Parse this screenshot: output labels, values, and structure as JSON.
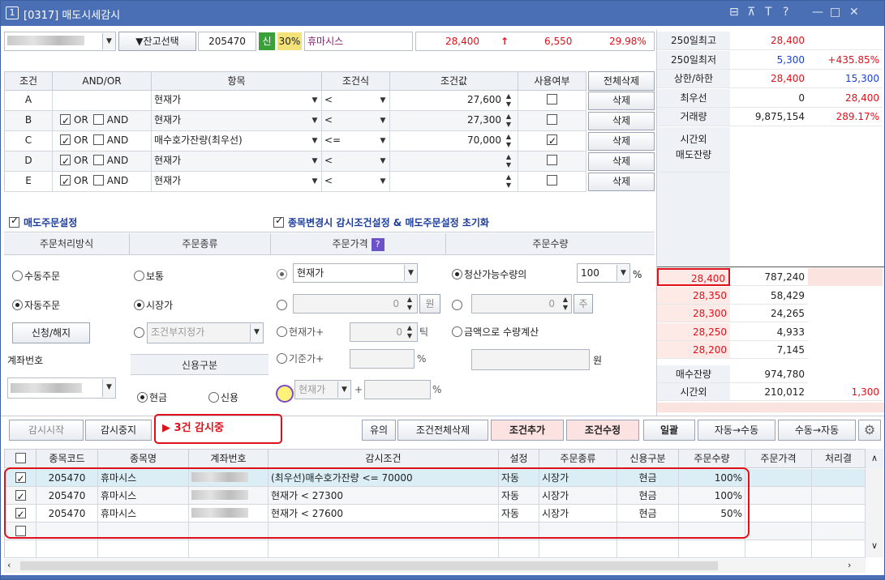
{
  "window": {
    "number": "1",
    "title": "[0317] 매도시세감시",
    "controls": [
      "⊟",
      "⊼",
      "T",
      "?",
      "—",
      "□",
      "✕"
    ]
  },
  "header": {
    "stock_select_label": "▼잔고선택",
    "code": "205470",
    "credit_badge": "신",
    "margin": "30%",
    "name": "휴마시스",
    "price": "28,400",
    "arrow": "↑",
    "change": "6,550",
    "change_rate": "29.98%"
  },
  "conditions": {
    "headers": [
      "조건",
      "AND/OR",
      "항목",
      "조건식",
      "조건값",
      "사용여부",
      "전체삭제"
    ],
    "rows": [
      {
        "id": "A",
        "or_checked": false,
        "or": "",
        "and": "",
        "item": "현재가",
        "op": "<",
        "value": "27,600",
        "use": false,
        "delete": "삭제"
      },
      {
        "id": "B",
        "or_checked": true,
        "or": "OR",
        "and": "AND",
        "item": "현재가",
        "op": "<",
        "value": "27,300",
        "use": false,
        "delete": "삭제"
      },
      {
        "id": "C",
        "or_checked": true,
        "or": "OR",
        "and": "AND",
        "item": "매수호가잔량(최우선)",
        "op": "<=",
        "value": "70,000",
        "use": true,
        "delete": "삭제"
      },
      {
        "id": "D",
        "or_checked": true,
        "or": "OR",
        "and": "AND",
        "item": "현재가",
        "op": "<",
        "value": "",
        "use": false,
        "delete": "삭제"
      },
      {
        "id": "E",
        "or_checked": true,
        "or": "OR",
        "and": "AND",
        "item": "현재가",
        "op": "<",
        "value": "",
        "use": false,
        "delete": "삭제"
      }
    ]
  },
  "order": {
    "sell_order_setting": "매도주문설정",
    "reset_label": "종목변경시 감시조건설정 & 매도주문설정 초기화",
    "col_method": "주문처리방식",
    "col_type": "주문종류",
    "col_price": "주문가격",
    "col_qty": "주문수량",
    "manual": "수동주문",
    "auto": "자동주문",
    "apply": "신청/해지",
    "account_label": "계좌번호",
    "normal": "보통",
    "market": "시장가",
    "conditional": "조건부지정가",
    "credit_section": "신용구분",
    "cash": "현금",
    "credit": "신용",
    "current_price": "현재가",
    "zero1": "0",
    "won1": "원",
    "current_plus": "현재가+",
    "zero2": "0",
    "tick": "틱",
    "base_plus": "기준가+",
    "pct": "%",
    "current_price2": "현재가",
    "plus": "+",
    "pct2": "%",
    "liquid_qty": "청산가능수량의",
    "liquid_pct": "100",
    "pct3": "%",
    "zero3": "0",
    "ju": "주",
    "by_amount": "금액으로 수량계산",
    "won2": "원"
  },
  "right_panel": {
    "rows": [
      {
        "label": "250일최고",
        "v1": "28,400",
        "v2": ""
      },
      {
        "label": "250일최저",
        "v1": "5,300",
        "v2": "+435.85%"
      },
      {
        "label": "상한/하한",
        "v1": "28,400",
        "v2": "15,300"
      },
      {
        "label": "최우선",
        "v1": "0",
        "v2": "28,400"
      },
      {
        "label": "거래량",
        "v1": "9,875,154",
        "v2": "289.17%"
      }
    ],
    "after_hours_sell": "시간외\n매도잔량",
    "bids": [
      {
        "price": "28,400",
        "qty": "787,240"
      },
      {
        "price": "28,350",
        "qty": "58,429"
      },
      {
        "price": "28,300",
        "qty": "24,265"
      },
      {
        "price": "28,250",
        "qty": "4,933"
      },
      {
        "price": "28,200",
        "qty": "7,145"
      }
    ],
    "bid_total_label": "매수잔량",
    "bid_total": "974,780",
    "after_hours_label": "시간외",
    "after_hours_qty": "210,012",
    "after_hours_val": "1,300"
  },
  "toolbar": {
    "start": "감시시작",
    "stop": "감시중지",
    "status": "▶ 3건 감시중",
    "notice": "유의",
    "delete_all": "조건전체삭제",
    "add": "조건추가",
    "edit": "조건수정",
    "batch": "일괄",
    "auto_manual": "자동→수동",
    "manual_auto": "수동→자동"
  },
  "list": {
    "headers": [
      "종목코드",
      "종목명",
      "계좌번호",
      "감시조건",
      "설정",
      "주문종류",
      "신용구분",
      "주문수량",
      "주문가격",
      "처리결"
    ],
    "rows": [
      {
        "checked": true,
        "code": "205470",
        "name": "휴마시스",
        "cond": "(최우선)매수호가잔량 <= 70000",
        "set": "자동",
        "type": "시장가",
        "credit": "현금",
        "qty": "100%"
      },
      {
        "checked": true,
        "code": "205470",
        "name": "휴마시스",
        "cond": "현재가 < 27300",
        "set": "자동",
        "type": "시장가",
        "credit": "현금",
        "qty": "100%"
      },
      {
        "checked": true,
        "code": "205470",
        "name": "휴마시스",
        "cond": "현재가 < 27600",
        "set": "자동",
        "type": "시장가",
        "credit": "현금",
        "qty": "50%"
      }
    ]
  }
}
